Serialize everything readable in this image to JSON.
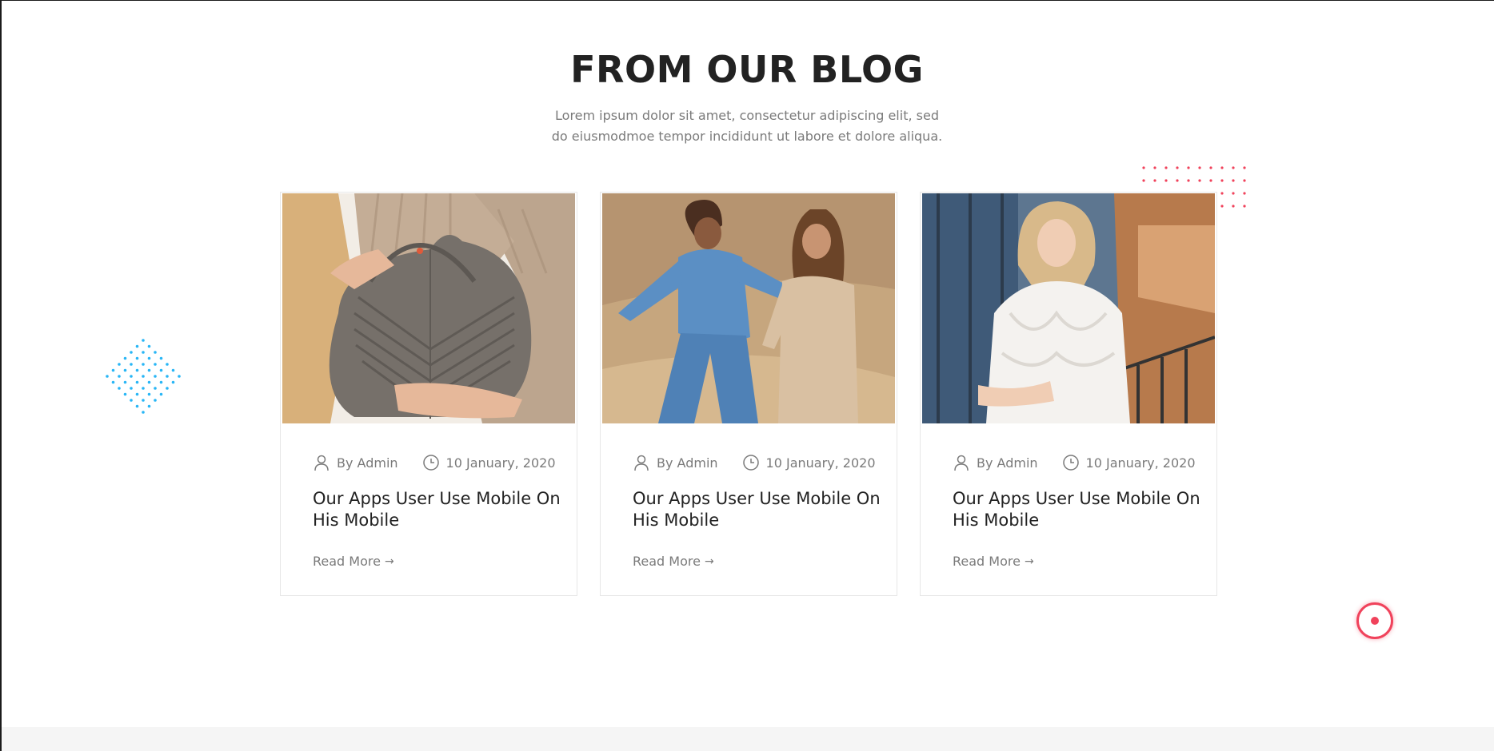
{
  "section": {
    "title": "FROM OUR BLOG",
    "subtitle": "Lorem ipsum dolor sit amet, consectetur adipiscing elit, sed do eiusmodmoe tempor incididunt ut labore et dolore aliqua."
  },
  "posts": [
    {
      "author": "By Admin",
      "date": "10 January, 2020",
      "title": "Our Apps User Use Mobile On His Mobile",
      "read_more": "Read More",
      "image": "handbag-photo"
    },
    {
      "author": "By Admin",
      "date": "10 January, 2020",
      "title": "Our Apps User Use Mobile On His Mobile",
      "read_more": "Read More",
      "image": "beach-friends-photo"
    },
    {
      "author": "By Admin",
      "date": "10 January, 2020",
      "title": "Our Apps User Use Mobile On His Mobile",
      "read_more": "Read More",
      "image": "white-blouse-photo"
    }
  ],
  "icons": {
    "author": "user-icon",
    "date": "clock-icon",
    "arrow": "arrow-right-icon"
  },
  "colors": {
    "accent": "#f0425b",
    "decor_blue": "#29b6f6",
    "heading": "#222222",
    "muted": "#7a7a7a"
  }
}
